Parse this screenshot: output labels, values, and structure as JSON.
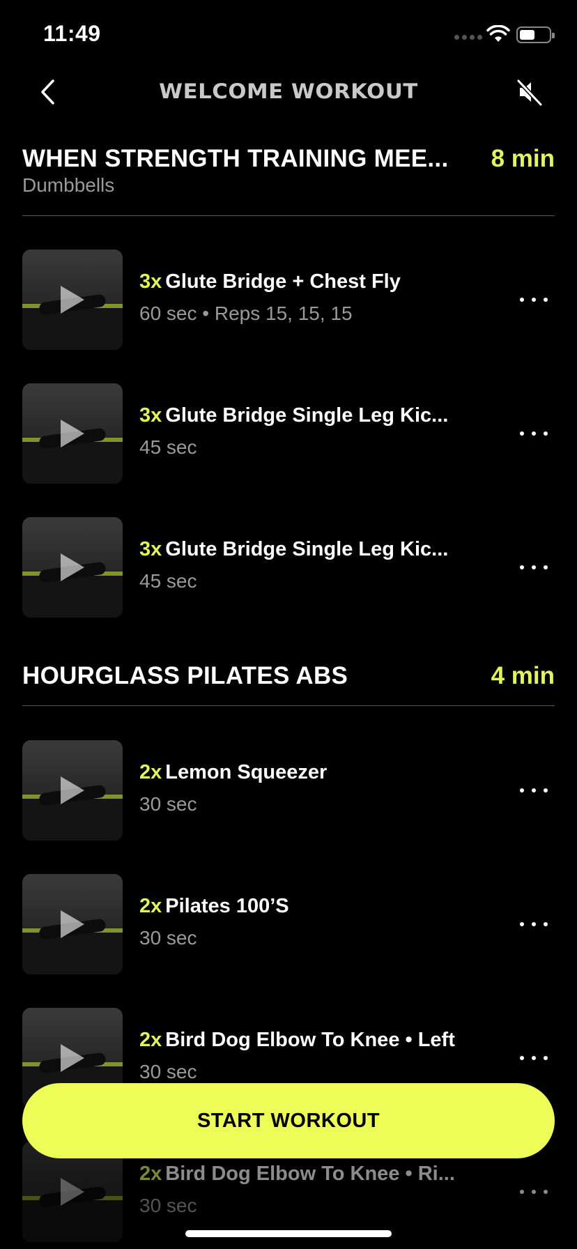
{
  "status_bar": {
    "time": "11:49"
  },
  "nav": {
    "title": "WELCOME WORKOUT"
  },
  "sections": [
    {
      "title": "WHEN STRENGTH TRAINING MEE...",
      "duration": "8 min",
      "subtitle": "Dumbbells",
      "exercises": [
        {
          "sets": "3x",
          "name": "Glute Bridge + Chest Fly",
          "meta": "60 sec • Reps 15, 15, 15"
        },
        {
          "sets": "3x",
          "name": "Glute Bridge Single Leg Kic...",
          "meta": "45 sec"
        },
        {
          "sets": "3x",
          "name": "Glute Bridge Single Leg Kic...",
          "meta": "45 sec"
        }
      ]
    },
    {
      "title": "HOURGLASS PILATES ABS",
      "duration": "4 min",
      "exercises": [
        {
          "sets": "2x",
          "name": "Lemon Squeezer",
          "meta": "30 sec"
        },
        {
          "sets": "2x",
          "name": "Pilates 100’S",
          "meta": "30 sec"
        },
        {
          "sets": "2x",
          "name": "Bird Dog Elbow To Knee • Left",
          "meta": "30 sec"
        },
        {
          "sets": "2x",
          "name": "Bird Dog Elbow To Knee • Ri...",
          "meta": "30 sec"
        }
      ]
    }
  ],
  "cta": {
    "label": "START WORKOUT"
  },
  "colors": {
    "accent": "#e3f55b",
    "button": "#eefc57",
    "background": "#000000"
  },
  "icons": [
    "chevron-left-icon",
    "speaker-muted-icon",
    "play-icon",
    "more-dots-icon",
    "wifi-icon",
    "battery-icon"
  ]
}
